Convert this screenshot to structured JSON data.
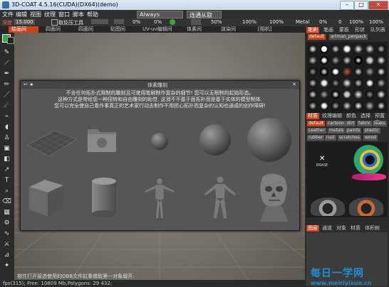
{
  "window": {
    "title": "3D-COAT 4.5.16(CUDA)(DX64)(demo)",
    "minimize": "–",
    "maximize": "□",
    "close": "✕"
  },
  "menu": [
    "文件",
    "编辑",
    "视图",
    "纹理",
    "窗口",
    "脚本",
    "帮助"
  ],
  "toolbar": {
    "mode_value": "Always",
    "mode2_value": "连通从取",
    "depth_label": "深度",
    "depth_value": "15.000",
    "smooth_label": "取反压工具",
    "pct1": "0%",
    "pct2": "0%",
    "pct3": "50%",
    "pct4": "100%",
    "pct5": "100%",
    "metal_label": "Metal",
    "metal_value": "0%",
    "val0": "0",
    "val100a": "100%",
    "val100b": "100%"
  },
  "room_tabs": [
    {
      "label": "绘画间",
      "active": true
    },
    {
      "label": "四面间",
      "active": false
    },
    {
      "label": "四面间",
      "active": false
    },
    {
      "label": "贴图间",
      "active": false
    },
    {
      "label": "UV-uv编辑间",
      "active": false
    },
    {
      "label": "体素间",
      "active": false
    },
    {
      "label": "渲染间",
      "active": false
    },
    {
      "label": "[相机]",
      "active": false
    }
  ],
  "dialog": {
    "title": "体素雕刻",
    "pin": "↩ ★",
    "close": "✕",
    "description": [
      "不含任何拓扑式限制的雕刻且可使用笔刷制作复杂的细节! 您可以无限制的起始形态。",
      "这种方式是带给您一种扭转和自由雕刻的助觉. 这消不不基于面拓扑而是基于实体的模型制体.",
      "您可以完全使自己看作事真正的艺术家行动去制作不用担心拓扑而复杂的认知也通成的创作障碍!"
    ],
    "items": [
      "grid-plane",
      "folder",
      "small-sphere",
      "medium-sphere",
      "large-sphere",
      "cube",
      "cylinder",
      "mannequin-female",
      "mannequin-male",
      "skull-bust"
    ]
  },
  "status": {
    "hint": "按住打开接选使用的OBB文件缸事缴取第一对象缀开.",
    "fps": "fps(315); Free: 10809 Mb,Polygons: 29 432;"
  },
  "right_panel": {
    "tabs_top": [
      {
        "label": "笔刷",
        "active": true
      },
      {
        "label": "笔画",
        "active": false
      },
      {
        "label": "蒙板",
        "active": false
      },
      {
        "label": "形状",
        "active": false
      },
      {
        "label": "队列表",
        "active": false
      }
    ],
    "brush_presets": [
      {
        "label": "default",
        "active": true
      },
      {
        "label": "artman_penpack",
        "active": false
      }
    ],
    "tabs_mid": [
      {
        "label": "材质",
        "active": true
      },
      {
        "label": "纹理编辑",
        "active": false
      },
      {
        "label": "颜色",
        "active": false
      },
      {
        "label": "选择",
        "active": false
      },
      {
        "label": "预置库",
        "active": false
      }
    ],
    "material_chips": [
      {
        "label": "default",
        "active": true
      },
      {
        "label": "cartoon",
        "active": false
      },
      {
        "label": "dirt",
        "active": false
      },
      {
        "label": "fabric",
        "active": false
      },
      {
        "label": "leaks",
        "active": false
      },
      {
        "label": "Leather",
        "active": false
      },
      {
        "label": "metals",
        "active": false
      },
      {
        "label": "paints",
        "active": false
      },
      {
        "label": "plastic",
        "active": false
      },
      {
        "label": "rubber",
        "active": false
      },
      {
        "label": "rust",
        "active": false
      },
      {
        "label": "scratches",
        "active": false
      },
      {
        "label": "wood",
        "active": false
      }
    ],
    "erase_label": "ERASE",
    "tabs_bottom": [
      {
        "label": "图层",
        "active": true
      },
      {
        "label": "通道",
        "active": false
      },
      {
        "label": "对象",
        "active": false
      },
      {
        "label": "材质",
        "active": false
      },
      {
        "label": "体积树",
        "active": false
      }
    ]
  },
  "watermark": {
    "line1": "每日一学网",
    "line2": "www.meiriyixue.cn"
  },
  "colors": {
    "accent": "#c8441c",
    "primary_color": "#3aa63a",
    "secondary_color": "#222222"
  }
}
